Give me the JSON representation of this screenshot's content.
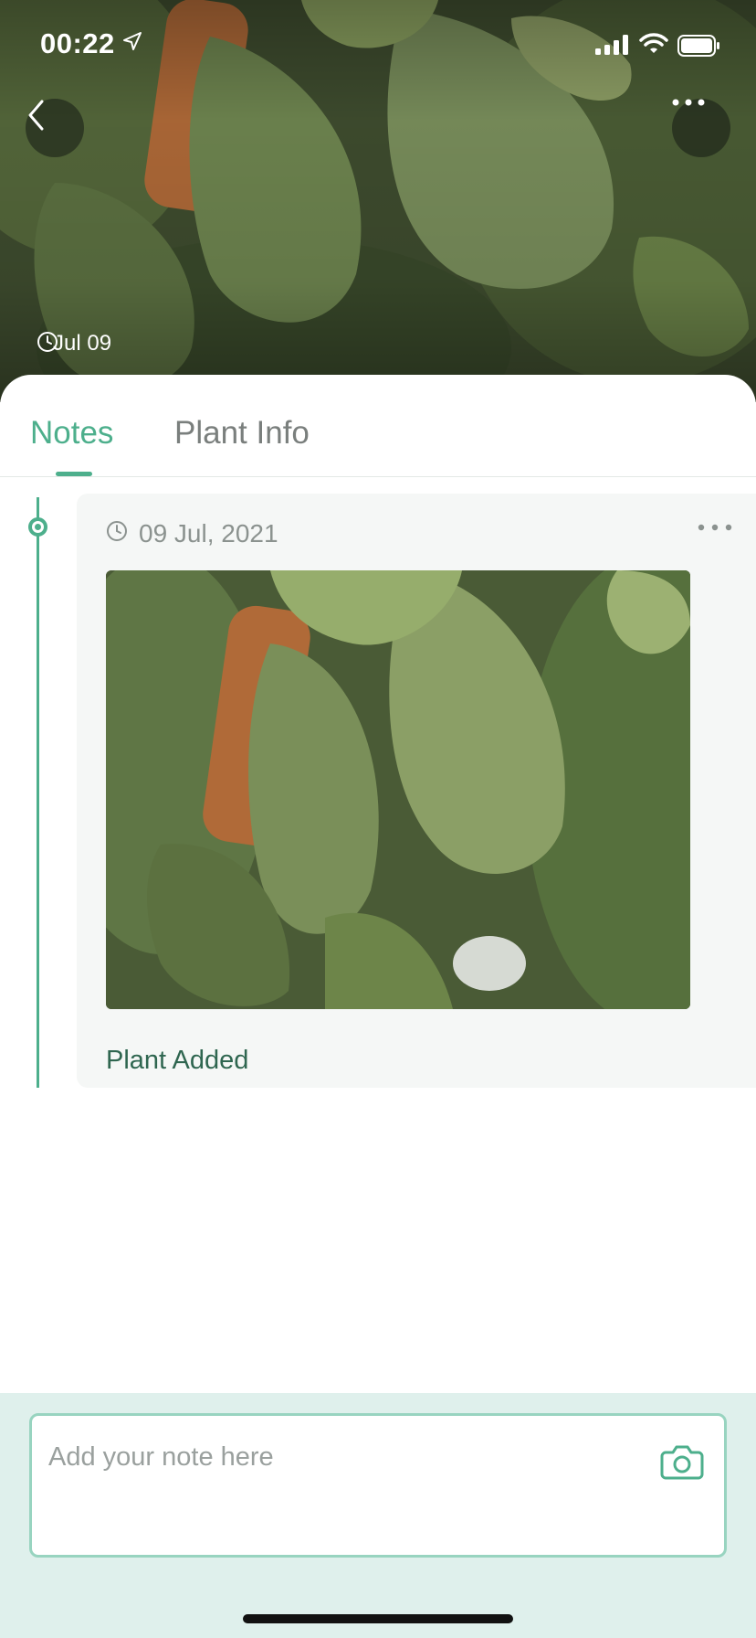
{
  "status_bar": {
    "time": "00:22"
  },
  "hero": {
    "date": "Jul 09"
  },
  "tabs": [
    {
      "label": "Notes",
      "active": true
    },
    {
      "label": "Plant Info",
      "active": false
    }
  ],
  "timeline": {
    "entries": [
      {
        "date": "09 Jul, 2021",
        "text": "Plant Added"
      }
    ]
  },
  "composer": {
    "placeholder": "Add your note here"
  },
  "colors": {
    "accent": "#4daf8c",
    "composer_bg": "#dff0ec",
    "composer_border": "#98d4c0",
    "card_bg": "#f5f7f6",
    "note_text": "#2f6650"
  },
  "icons": {
    "back": "chevron-left-icon",
    "more": "more-horizontal-icon",
    "clock": "clock-icon",
    "camera": "camera-icon",
    "location": "location-arrow-icon",
    "signal": "signal-icon",
    "wifi": "wifi-icon",
    "battery": "battery-icon"
  }
}
